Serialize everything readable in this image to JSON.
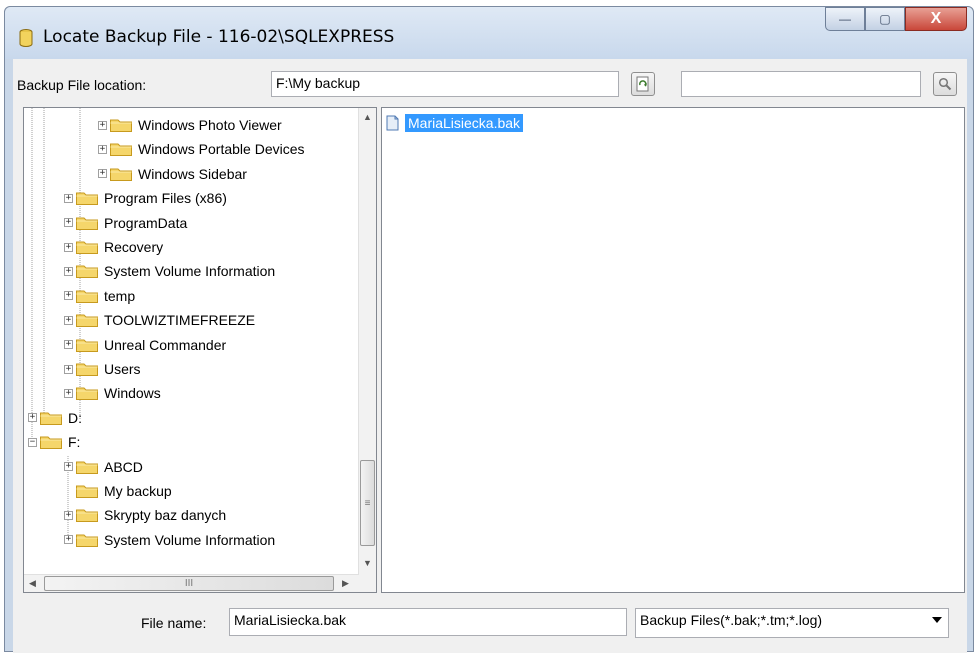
{
  "window": {
    "title": "Locate Backup File - 116-02\\SQLEXPRESS",
    "buttons": {
      "minimize": "—",
      "maximize": "▢",
      "close": "X"
    }
  },
  "location": {
    "label": "Backup File location:",
    "value": "F:\\My backup",
    "search_value": ""
  },
  "tree": {
    "nodes": [
      {
        "label": "Windows Photo Viewer",
        "expander": "+"
      },
      {
        "label": "Windows Portable Devices",
        "expander": "+"
      },
      {
        "label": "Windows Sidebar",
        "expander": "+"
      },
      {
        "label": "Program Files (x86)",
        "expander": "+"
      },
      {
        "label": "ProgramData",
        "expander": "+"
      },
      {
        "label": "Recovery",
        "expander": "+"
      },
      {
        "label": "System Volume Information",
        "expander": "+"
      },
      {
        "label": "temp",
        "expander": "+"
      },
      {
        "label": "TOOLWIZTIMEFREEZE",
        "expander": "+"
      },
      {
        "label": "Unreal Commander",
        "expander": "+"
      },
      {
        "label": "Users",
        "expander": "+"
      },
      {
        "label": "Windows",
        "expander": "+"
      },
      {
        "label": "D:",
        "expander": "+"
      },
      {
        "label": "F:",
        "expander": "−"
      },
      {
        "label": "ABCD",
        "expander": "+"
      },
      {
        "label": "My backup",
        "expander": ""
      },
      {
        "label": "Skrypty baz danych",
        "expander": "+"
      },
      {
        "label": "System Volume Information",
        "expander": "+"
      }
    ],
    "scroll_grip": "≡",
    "hscroll_grip": "III"
  },
  "files": [
    {
      "name": "MariaLisiecka.bak",
      "selected": true
    }
  ],
  "footer": {
    "filename_label": "File name:",
    "filename_value": "MariaLisiecka.bak",
    "filetype_value": "Backup Files(*.bak;*.tm;*.log)"
  },
  "colors": {
    "selection": "#3399ff",
    "folder": "#f5d66b"
  }
}
